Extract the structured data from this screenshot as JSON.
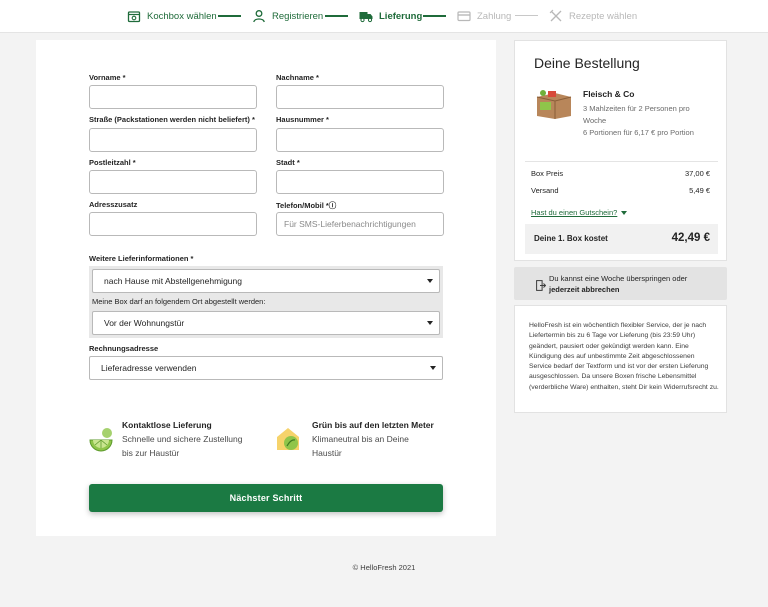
{
  "stepper": {
    "steps": [
      {
        "label": "Kochbox wählen",
        "icon": "box-icon",
        "state": "done"
      },
      {
        "label": "Registrieren",
        "icon": "user-icon",
        "state": "done"
      },
      {
        "label": "Lieferung",
        "icon": "truck-icon",
        "state": "current"
      },
      {
        "label": "Zahlung",
        "icon": "card-icon",
        "state": "upcoming"
      },
      {
        "label": "Rezepte wählen",
        "icon": "cutlery-icon",
        "state": "upcoming"
      }
    ],
    "accent": "#1f6b3a"
  },
  "form": {
    "firstname_label": "Vorname *",
    "lastname_label": "Nachname *",
    "street_label": "Straße (Packstationen werden nicht beliefert) *",
    "housenumber_label": "Hausnummer *",
    "zip_label": "Postleitzahl *",
    "city_label": "Stadt *",
    "address_extra_label": "Adresszusatz",
    "phone_label": "Telefon/Mobil *ⓘ",
    "phone_placeholder": "Für SMS-Lieferbenachrichtigungen",
    "delivery_info_label": "Weitere Lieferinformationen *",
    "delivery_info_value": "nach Hause mit Abstellgenehmigung",
    "drop_place_label": "Meine Box darf an folgendem Ort abgestellt werden:",
    "drop_place_value": "Vor der Wohnungstür",
    "billing_label": "Rechnungsadresse",
    "billing_value": "Lieferadresse verwenden"
  },
  "features": [
    {
      "icon": "lime-icon",
      "title": "Kontaktlose Lieferung",
      "line1": "Schnelle und sichere Zustellung",
      "line2": "bis zur Haustür"
    },
    {
      "icon": "eco-house-icon",
      "title": "Grün bis auf den letzten Meter",
      "line1": "Klimaneutral bis an Deine",
      "line2": "Haustür"
    }
  ],
  "cta": {
    "label": "Nächster Schritt",
    "color": "#1b7a43"
  },
  "order": {
    "title": "Deine Bestellung",
    "product_name": "Fleisch & Co",
    "product_line1": "3 Mahlzeiten für 2 Personen pro",
    "product_line2": "Woche",
    "product_line3": "6 Portionen für 6,17 € pro Portion",
    "box_price_label": "Box Preis",
    "box_price_value": "37,00 €",
    "shipping_label": "Versand",
    "shipping_value": "5,49 €",
    "voucher_link": "Hast du einen Gutschein?",
    "total_label": "Deine 1. Box kostet",
    "total_value": "42,49 €"
  },
  "skip": {
    "line1": "Du kannst eine Woche überspringen oder",
    "line2": "jederzeit abbrechen"
  },
  "info": {
    "text": "HelloFresh ist ein wöchentlich flexibler Service, der je nach Liefertermin bis zu 6 Tage vor Lieferung (bis 23:59 Uhr) geändert, pausiert oder gekündigt werden kann. Eine Kündigung des auf unbestimmte Zeit abgeschlossenen Service bedarf der Textform und ist vor der ersten Lieferung ausgeschlossen. Da unsere Boxen frische Lebensmittel (verderbliche Ware) enthalten, steht Dir kein Widerrufsrecht zu."
  },
  "footer": {
    "text": "© HelloFresh 2021"
  }
}
